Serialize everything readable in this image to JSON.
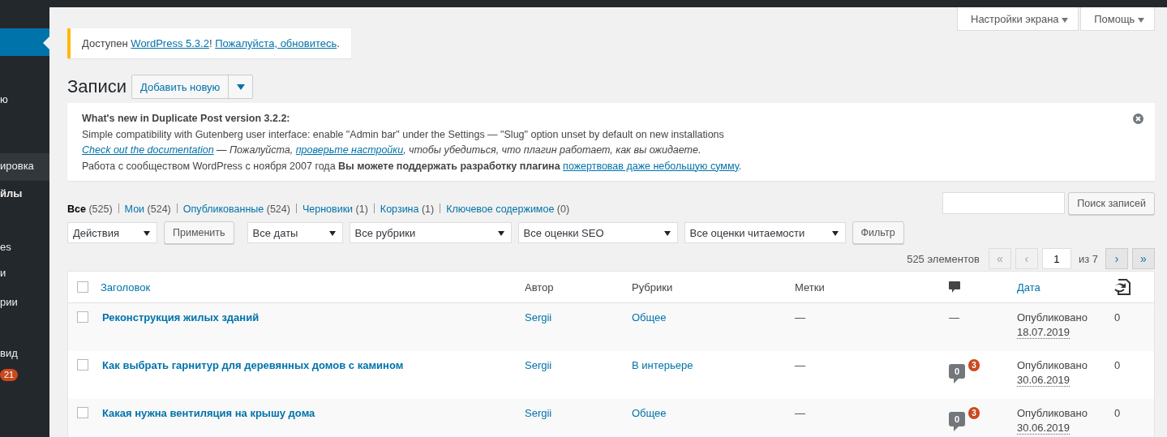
{
  "sidebar": {
    "items": [
      {
        "selected": true
      },
      {
        "label": "ю",
        "selected": false,
        "bold": false
      },
      {
        "label": "ировка",
        "selected": false,
        "bold": false
      },
      {
        "label": "йлы",
        "selected": false,
        "bold": true
      },
      {
        "label": "es",
        "selected": false,
        "bold": false
      },
      {
        "label": "и",
        "selected": false,
        "bold": false
      },
      {
        "label": "рии",
        "selected": false,
        "bold": false
      },
      {
        "label": "вид",
        "selected": false,
        "bold": false
      },
      {
        "badge": "21",
        "selected": false
      }
    ]
  },
  "screen_tabs": [
    "Настройки экрана",
    "Помощь"
  ],
  "update_notice": {
    "text": "Доступен ",
    "link1": "WordPress 5.3.2",
    "sep": "! ",
    "link2": "Пожалуйста, обновитесь",
    "end": "."
  },
  "page_title": "Записи",
  "add_button": "Добавить новую",
  "plugin_notice": {
    "title": "What's new in Duplicate Post version 3.2.2:",
    "line1": "Simple compatibility with Gutenberg user interface: enable \"Admin bar\" under the Settings — \"Slug\" option unset by default on new installations",
    "doc_link": "Check out the documentation",
    "line2_mid": " — Пожалуйста, ",
    "settings_link": "проверьте настройки",
    "line2_end": ", чтобы убедиться, что плагин работает, как вы ожидаете.",
    "line3": "Работа с сообществом WordPress с ноября 2007 года **Вы можете поддержать разработку плагина** ",
    "donate_link": "пожертвовав даже небольшую сумму",
    "line3_end": "."
  },
  "views": [
    {
      "label": "Все",
      "count": "(525)",
      "selected": true
    },
    {
      "label": "Мои",
      "count": "(524)",
      "selected": false
    },
    {
      "label": "Опубликованные",
      "count": "(524)",
      "selected": false
    },
    {
      "label": "Черновики",
      "count": "(1)",
      "selected": false
    },
    {
      "label": "Корзина",
      "count": "(1)",
      "selected": false
    },
    {
      "label": "Ключевое содержимое",
      "count": "(0)",
      "selected": false
    }
  ],
  "search_button": "Поиск записей",
  "bulk_action": "Действия",
  "apply_button": "Применить",
  "filters": [
    "Все даты",
    "Все рубрики",
    "Все оценки SEO",
    "Все оценки читаемости"
  ],
  "filter_button": "Фильтр",
  "pagination": {
    "count": "525 элементов",
    "first": "«",
    "prev": "‹",
    "page": "1",
    "of": "из 7",
    "next": "›",
    "last": "»"
  },
  "table": {
    "all_checked": false,
    "columns": [
      "Заголовок",
      "Автор",
      "Рубрики",
      "Метки",
      "Дата"
    ],
    "rows": [
      {
        "title": "Реконструкция жилых зданий",
        "author": "Sergii",
        "category": "Общее",
        "tags": "—",
        "comments": {
          "kind": "none",
          "text": "—"
        },
        "status": "Опубликовано",
        "date": "18.07.2019",
        "column_8": "0",
        "checked": false
      },
      {
        "title": "Как выбрать гарнитур для деревянных домов с камином",
        "author": "Sergii",
        "category": "В интерьере",
        "tags": "—",
        "comments": {
          "kind": "bubble",
          "approved": "0",
          "pending": "3"
        },
        "status": "Опубликовано",
        "date": "30.06.2019",
        "column_8": "0",
        "checked": false
      },
      {
        "title": "Какая нужна вентиляция на крышу дома",
        "author": "Sergii",
        "category": "Общее",
        "tags": "—",
        "comments": {
          "kind": "bubble",
          "approved": "0",
          "pending": "3"
        },
        "status": "Опубликовано",
        "date": "30.06.2019",
        "column_8": "0",
        "checked": false
      }
    ]
  }
}
